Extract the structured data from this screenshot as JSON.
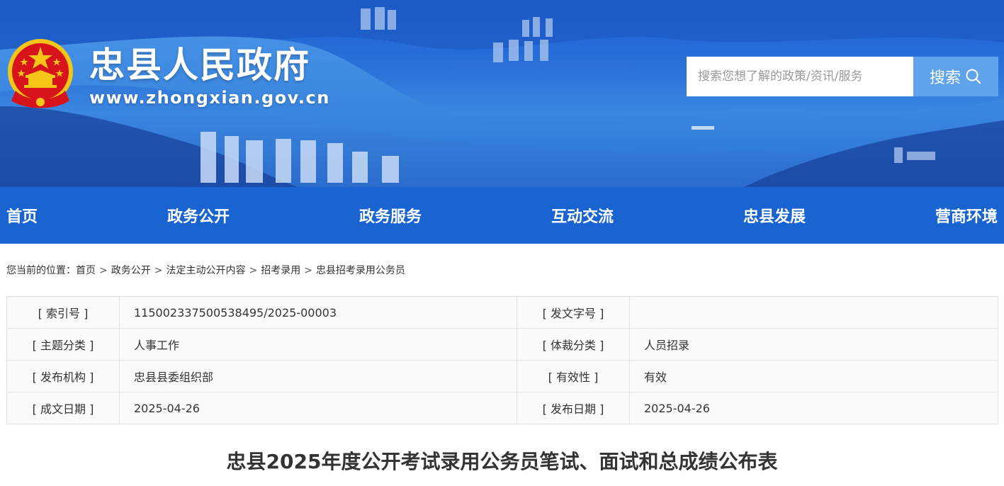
{
  "header": {
    "site_title": "忠县人民政府",
    "site_url": "www.zhongxian.gov.cn",
    "emblem": "national-emblem",
    "search_placeholder": "搜索您想了解的政策/资讯/服务",
    "search_button_label": "搜索",
    "search_icon": "search-icon"
  },
  "nav": {
    "items": [
      {
        "label": "首页"
      },
      {
        "label": "政务公开"
      },
      {
        "label": "政务服务"
      },
      {
        "label": "互动交流"
      },
      {
        "label": "忠县发展"
      },
      {
        "label": "营商环境"
      }
    ]
  },
  "breadcrumb": {
    "prefix": "您当前的位置：",
    "separator": ">",
    "items": [
      "首页",
      "政务公开",
      "法定主动公开内容",
      "招考录用",
      "忠县招考录用公务员"
    ]
  },
  "info_table": {
    "rows": [
      {
        "label1": "[ 索引号 ]",
        "value1": "115002337500538495/2025-00003",
        "label2": "[ 发文字号 ]",
        "value2": ""
      },
      {
        "label1": "[ 主题分类 ]",
        "value1": "人事工作",
        "label2": "[ 体裁分类 ]",
        "value2": "人员招录"
      },
      {
        "label1": "[ 发布机构 ]",
        "value1": "忠县县委组织部",
        "label2": "[ 有效性 ]",
        "value2": "有效"
      },
      {
        "label1": "[ 成文日期 ]",
        "value1": "2025-04-26",
        "label2": "[ 发布日期 ]",
        "value2": "2025-04-26"
      }
    ]
  },
  "article": {
    "title": "忠县2025年度公开考试录用公务员笔试、面试和总成绩公布表"
  },
  "colors": {
    "nav_bg": "#1a64d2",
    "search_button_bg": "#5fa3ec",
    "emblem_red": "#d7131b",
    "emblem_gold": "#f5c518"
  }
}
